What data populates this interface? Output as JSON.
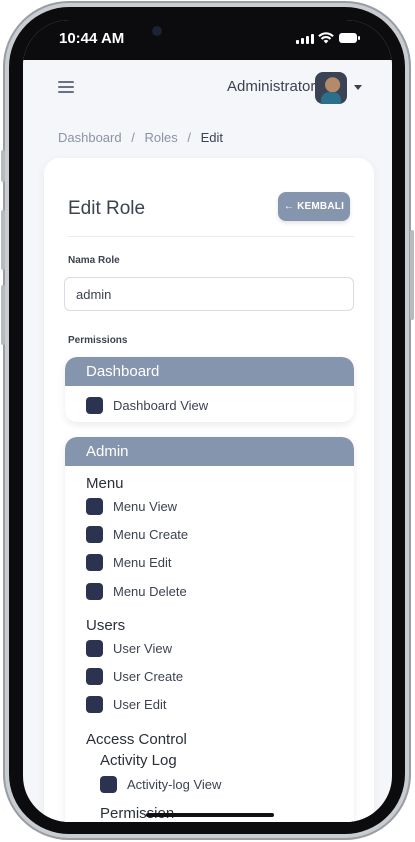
{
  "status_bar": {
    "time": "10:44 AM"
  },
  "header": {
    "user_name": "Administrator"
  },
  "breadcrumb": {
    "items": [
      "Dashboard",
      "Roles",
      "Edit"
    ],
    "separator": "/"
  },
  "card": {
    "title": "Edit Role",
    "back_button": "← KEMBALI",
    "role_field": {
      "label": "Nama Role",
      "value": "admin"
    },
    "permissions_label": "Permissions"
  },
  "groups": {
    "dashboard": {
      "title": "Dashboard",
      "items": [
        "Dashboard View"
      ]
    },
    "admin": {
      "title": "Admin",
      "menu": {
        "title": "Menu",
        "items": [
          "Menu View",
          "Menu Create",
          "Menu Edit",
          "Menu Delete"
        ]
      },
      "users": {
        "title": "Users",
        "items": [
          "User View",
          "User Create",
          "User Edit"
        ]
      },
      "access_control": {
        "title": "Access Control",
        "activity_log": {
          "title": "Activity Log",
          "items": [
            "Activity-log View"
          ]
        },
        "permission": {
          "title": "Permission"
        }
      }
    }
  },
  "colors": {
    "accent": "#8595ad",
    "checkbox": "#2c3350",
    "text": "#3c4250",
    "background": "#f4f6f9"
  }
}
